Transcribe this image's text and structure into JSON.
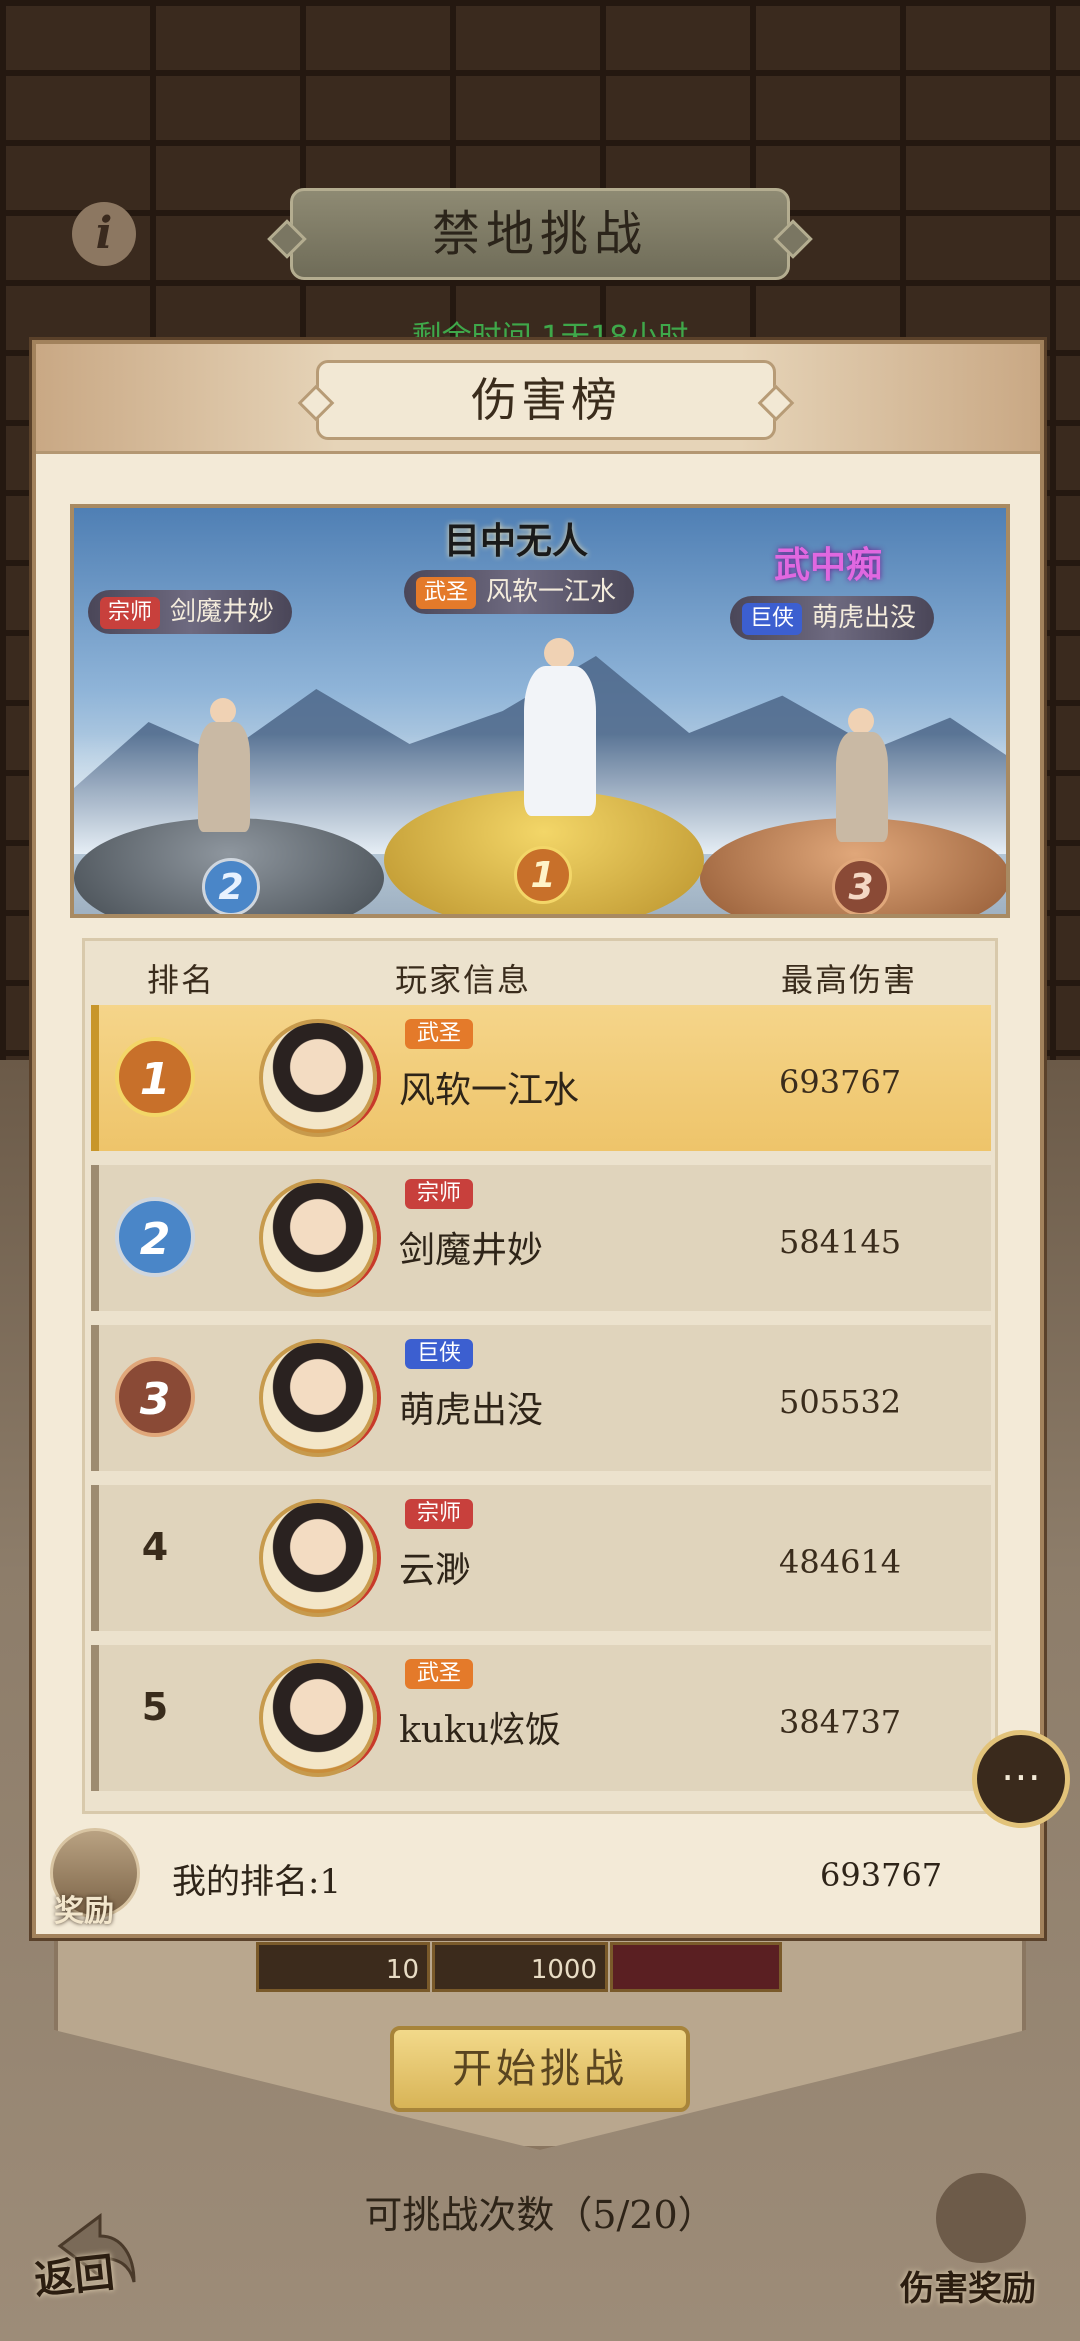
{
  "background": {
    "title": "禁地挑战",
    "remaining_time": "剩余时间 1天18小时",
    "start_button": "开始挑战",
    "attempts": "可挑战次数（5/20）",
    "back_label": "返回",
    "damage_reward_label": "伤害奖励",
    "bottom_items": [
      {
        "count": "10"
      },
      {
        "count": "1000"
      },
      {
        "count": ""
      }
    ]
  },
  "modal": {
    "title": "伤害榜",
    "podium": {
      "logo_first": "目中无人",
      "logo_third": "武中痴",
      "first": {
        "rank": "1",
        "title_chip": "武圣",
        "name": "风软一江水"
      },
      "second": {
        "rank": "2",
        "title_chip": "宗师",
        "name": "剑魔井妙"
      },
      "third": {
        "rank": "3",
        "title_chip": "巨侠",
        "name": "萌虎出没"
      }
    },
    "table": {
      "headers": {
        "rank": "排名",
        "player": "玩家信息",
        "damage": "最高伤害"
      },
      "rows": [
        {
          "rank": "1",
          "title_chip": "武圣",
          "name": "风软一江水",
          "damage": "693767",
          "chip_color": "#e47a2a"
        },
        {
          "rank": "2",
          "title_chip": "宗师",
          "name": "剑魔井妙",
          "damage": "584145",
          "chip_color": "#c8403c"
        },
        {
          "rank": "3",
          "title_chip": "巨侠",
          "name": "萌虎出没",
          "damage": "505532",
          "chip_color": "#3c5fd0"
        },
        {
          "rank": "4",
          "title_chip": "宗师",
          "name": "云渺",
          "damage": "484614",
          "chip_color": "#c8403c"
        },
        {
          "rank": "5",
          "title_chip": "武圣",
          "name": "kuku炫饭",
          "damage": "384737",
          "chip_color": "#e47a2a"
        }
      ]
    },
    "my_rank": {
      "label": "我的排名:1",
      "damage": "693767",
      "reward_label": "奖励"
    }
  },
  "colors": {
    "gold": "#e8b84a",
    "silver": "#4a86c8",
    "bronze": "#8a4a36",
    "panel": "#f3ead7",
    "accent_green": "#3fa84a"
  }
}
